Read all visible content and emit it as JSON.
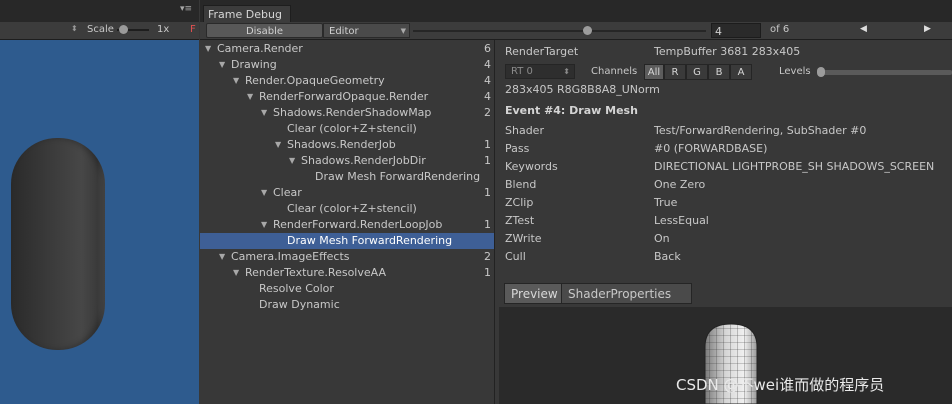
{
  "game": {
    "scale_label": "Scale",
    "scale_value": "1x",
    "trailing": "F"
  },
  "frame_debug": {
    "tab_title": "Frame Debug",
    "disable_label": "Disable",
    "editor_label": "Editor",
    "event_index": "4",
    "event_of": "of 6"
  },
  "tree": [
    {
      "label": "Camera.Render",
      "count": "6",
      "expanded": true
    },
    {
      "label": "Drawing",
      "count": "4",
      "expanded": true
    },
    {
      "label": "Render.OpaqueGeometry",
      "count": "4",
      "expanded": true
    },
    {
      "label": "RenderForwardOpaque.Render",
      "count": "4",
      "expanded": true
    },
    {
      "label": "Shadows.RenderShadowMap",
      "count": "2",
      "expanded": true
    },
    {
      "label": "Clear (color+Z+stencil)",
      "count": ""
    },
    {
      "label": "Shadows.RenderJob",
      "count": "1",
      "expanded": true
    },
    {
      "label": "Shadows.RenderJobDir",
      "count": "1",
      "expanded": true
    },
    {
      "label": "Draw Mesh ForwardRendering",
      "count": ""
    },
    {
      "label": "Clear",
      "count": "1",
      "expanded": true
    },
    {
      "label": "Clear (color+Z+stencil)",
      "count": ""
    },
    {
      "label": "RenderForward.RenderLoopJob",
      "count": "1",
      "expanded": true
    },
    {
      "label": "Draw Mesh ForwardRendering",
      "count": "",
      "selected": true
    },
    {
      "label": "Camera.ImageEffects",
      "count": "2",
      "expanded": true
    },
    {
      "label": "RenderTexture.ResolveAA",
      "count": "1",
      "expanded": true
    },
    {
      "label": "Resolve Color",
      "count": ""
    },
    {
      "label": "Draw Dynamic",
      "count": ""
    }
  ],
  "details": {
    "render_target_label": "RenderTarget",
    "render_target_value": "TempBuffer 3681 283x405",
    "rt_select": "RT 0",
    "channels_label": "Channels",
    "channels": [
      "All",
      "R",
      "G",
      "B",
      "A"
    ],
    "channels_selected": "All",
    "levels_label": "Levels",
    "format": "283x405 R8G8B8A8_UNorm",
    "event_title": "Event #4: Draw Mesh",
    "properties": [
      {
        "key": "Shader",
        "value": "Test/ForwardRendering, SubShader #0"
      },
      {
        "key": "Pass",
        "value": "#0 (FORWARDBASE)"
      },
      {
        "key": "Keywords",
        "value": "DIRECTIONAL LIGHTPROBE_SH SHADOWS_SCREEN"
      },
      {
        "key": "Blend",
        "value": "One Zero"
      },
      {
        "key": "ZClip",
        "value": "True"
      },
      {
        "key": "ZTest",
        "value": "LessEqual"
      },
      {
        "key": "ZWrite",
        "value": "On"
      },
      {
        "key": "Cull",
        "value": "Back"
      }
    ],
    "tabs": [
      "Preview",
      "ShaderProperties"
    ]
  },
  "watermark": "CSDN @不wei谁而做的程序员",
  "colors": {
    "selection": "#3e5f96",
    "game_background": "#2e5b8e",
    "panel": "#383838",
    "toolbar": "#3c3c3c"
  }
}
